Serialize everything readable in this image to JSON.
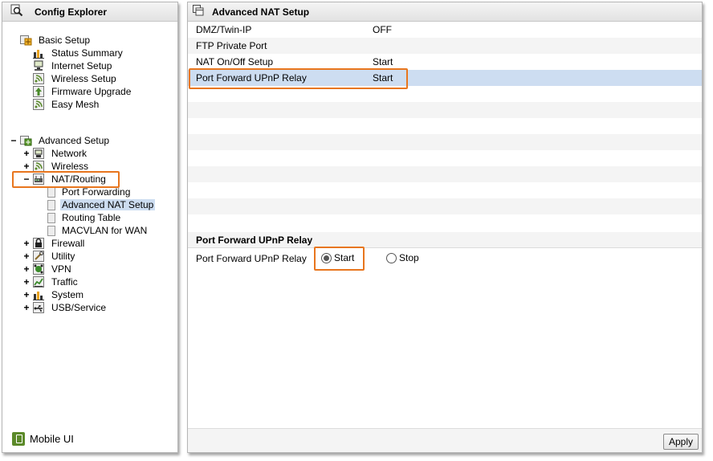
{
  "left_panel": {
    "title": "Config Explorer",
    "tree": {
      "basic_setup": {
        "label": "Basic Setup",
        "items": [
          "Status Summary",
          "Internet Setup",
          "Wireless Setup",
          "Firmware Upgrade",
          "Easy Mesh"
        ]
      },
      "advanced_setup": {
        "label": "Advanced Setup",
        "toggle": "−",
        "network": "Network",
        "wireless": "Wireless",
        "nat_routing": {
          "label": "NAT/Routing",
          "toggle": "−",
          "items": [
            "Port Forwarding",
            "Advanced NAT Setup",
            "Routing Table",
            "MACVLAN for WAN"
          ]
        },
        "rest": [
          "Firewall",
          "Utility",
          "VPN",
          "Traffic",
          "System",
          "USB/Service"
        ],
        "expand_toggle": "+"
      }
    },
    "mobile_ui": "Mobile UI"
  },
  "right_panel": {
    "title": "Advanced NAT Setup",
    "rows": [
      {
        "name": "DMZ/Twin-IP",
        "value": "OFF"
      },
      {
        "name": "FTP Private Port",
        "value": ""
      },
      {
        "name": "NAT On/Off Setup",
        "value": "Start"
      },
      {
        "name": "Port Forward UPnP Relay",
        "value": "Start"
      }
    ],
    "section": {
      "title": "Port Forward UPnP Relay",
      "field_label": "Port Forward UPnP Relay",
      "options": [
        {
          "label": "Start",
          "selected": true
        },
        {
          "label": "Stop",
          "selected": false
        }
      ]
    },
    "apply_label": "Apply"
  },
  "colors": {
    "highlight": "#cdddf1",
    "callout": "#e8761e",
    "alt_row": "#f4f4f4"
  }
}
